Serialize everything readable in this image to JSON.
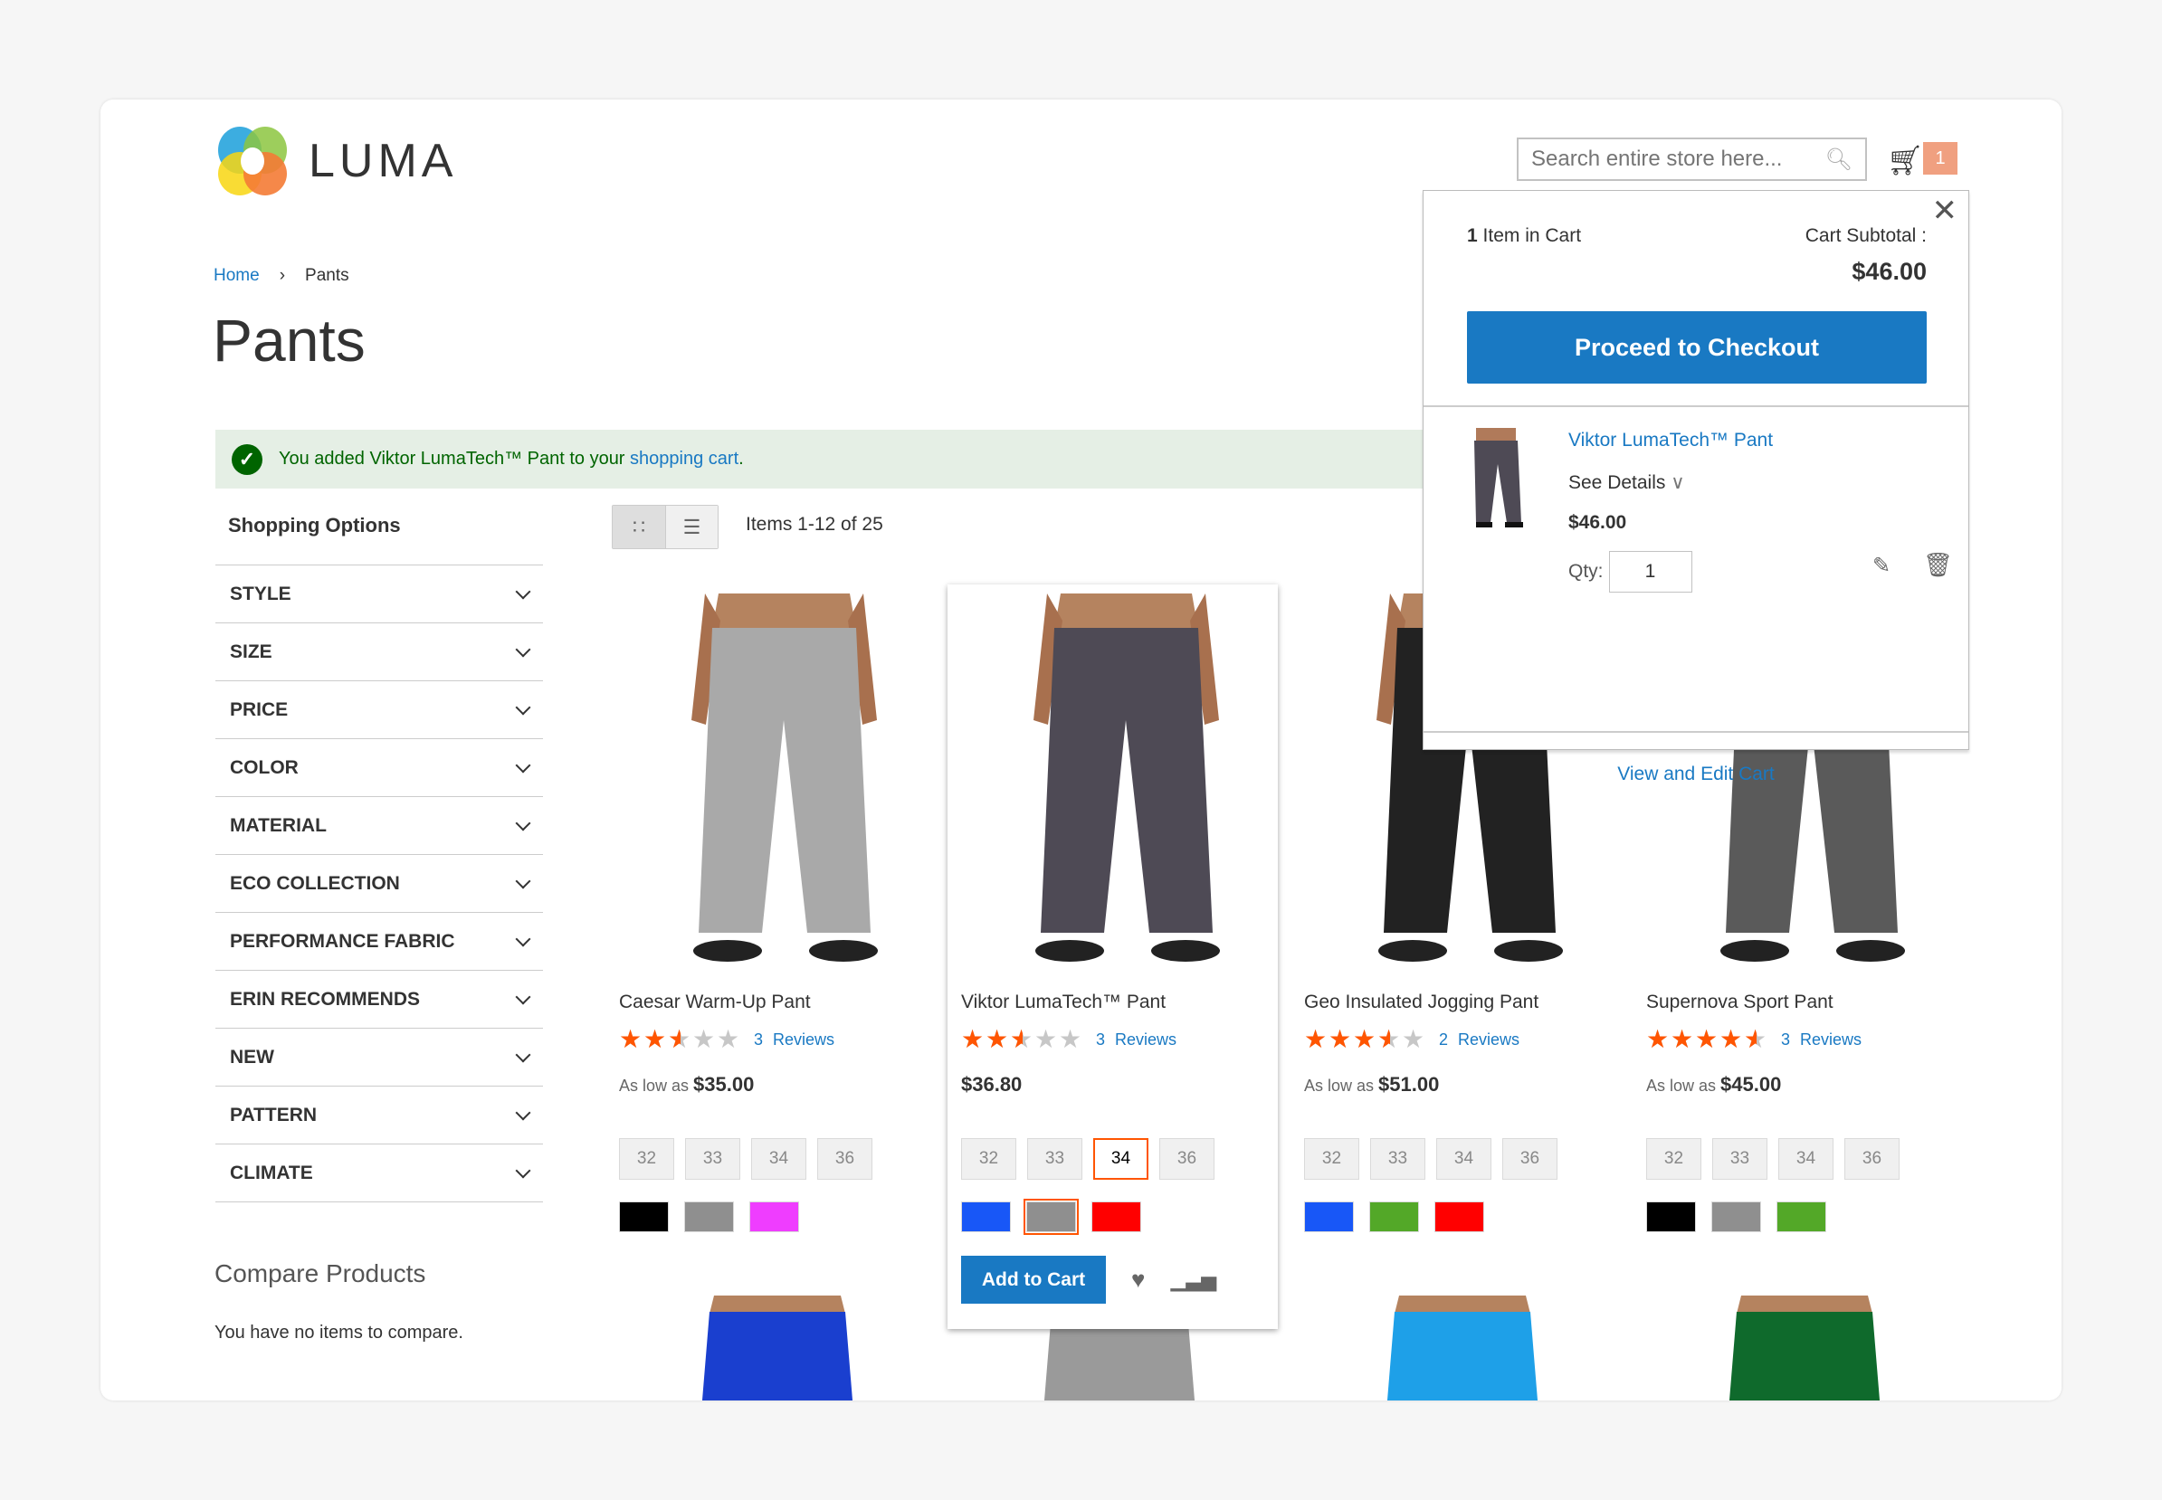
{
  "header": {
    "logo_text": "LUMA",
    "search_placeholder": "Search entire store here...",
    "cart_count": "1"
  },
  "breadcrumb": {
    "home": "Home",
    "separator": "›",
    "current": "Pants"
  },
  "page_title": "Pants",
  "message": {
    "prefix": "You added Viktor LumaTech™ Pant to your ",
    "link": "shopping cart",
    "suffix": "."
  },
  "sidebar": {
    "title": "Shopping Options",
    "filters": [
      "STYLE",
      "SIZE",
      "PRICE",
      "COLOR",
      "MATERIAL",
      "ECO COLLECTION",
      "PERFORMANCE FABRIC",
      "ERIN RECOMMENDS",
      "NEW",
      "PATTERN",
      "CLIMATE"
    ],
    "compare_title": "Compare Products",
    "compare_text": "You have no items to compare."
  },
  "toolbar": {
    "grid_icon": "grid-icon",
    "list_icon": "list-icon",
    "amount": "Items 1-12 of 25"
  },
  "products": [
    {
      "name": "Caesar Warm-Up Pant",
      "rating": 2.5,
      "reviews": "3  Reviews",
      "price_prefix": "As low as",
      "price": "$35.00",
      "sizes": [
        "32",
        "33",
        "34",
        "36"
      ],
      "colors": [
        "#000000",
        "#8f8f8f",
        "#ef3dff"
      ],
      "pant_color": "#a9a9a9"
    },
    {
      "name": "Viktor LumaTech™ Pant",
      "rating": 2.5,
      "reviews": "3  Reviews",
      "price_prefix": "",
      "price": "$36.80",
      "sizes": [
        "32",
        "33",
        "34",
        "36"
      ],
      "selected_size": "34",
      "colors": [
        "#1857f7",
        "#8f8f8f",
        "#ff0000"
      ],
      "selected_color": 1,
      "pant_color": "#4e4a55",
      "add_to_cart": "Add to Cart"
    },
    {
      "name": "Geo Insulated Jogging Pant",
      "rating": 3.5,
      "reviews": "2  Reviews",
      "price_prefix": "As low as",
      "price": "$51.00",
      "sizes": [
        "32",
        "33",
        "34",
        "36"
      ],
      "colors": [
        "#1857f7",
        "#53a828",
        "#ff0000"
      ],
      "pant_color": "#222222"
    },
    {
      "name": "Supernova Sport Pant",
      "rating": 4.5,
      "reviews": "3  Reviews",
      "price_prefix": "As low as",
      "price": "$45.00",
      "sizes": [
        "32",
        "33",
        "34",
        "36"
      ],
      "colors": [
        "#000000",
        "#8f8f8f",
        "#53a828"
      ],
      "pant_color": "#5a5a5a"
    }
  ],
  "second_row_colors": [
    "#1a3fcf",
    "#9a9a9a",
    "#1ea0e8",
    "#0f6a2c"
  ],
  "minicart": {
    "count": "1",
    "count_label": " Item in Cart",
    "subtotal_label": "Cart Subtotal :",
    "subtotal": "$46.00",
    "checkout": "Proceed to Checkout",
    "item_name": "Viktor LumaTech™ Pant",
    "see_details": "See Details",
    "item_price": "$46.00",
    "qty_label": "Qty:",
    "qty": "1",
    "view_edit": "View and Edit Cart"
  },
  "colors": {
    "accent": "#1979c3",
    "star": "#ff5501",
    "success_bg": "#e5efe5",
    "success_text": "#006400"
  }
}
